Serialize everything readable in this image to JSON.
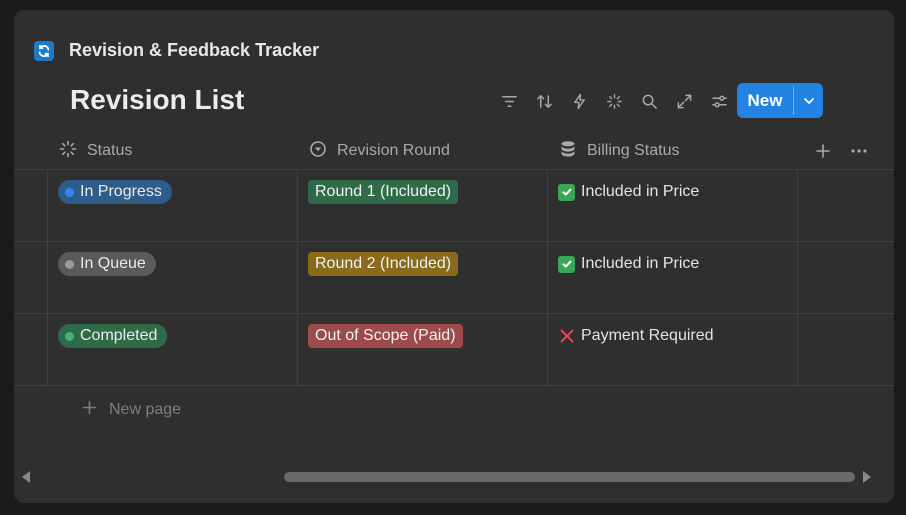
{
  "database": {
    "title": "Revision & Feedback Tracker",
    "icon": "sync-icon"
  },
  "view": {
    "title": "Revision List"
  },
  "toolbar": {
    "icons": [
      "filter-icon",
      "sort-icon",
      "automation-icon",
      "ai-sparkle-icon",
      "search-icon",
      "expand-icon",
      "settings-sliders-icon"
    ],
    "new_label": "New"
  },
  "columns": [
    {
      "label": "Status",
      "icon": "status-spinner-icon"
    },
    {
      "label": "Revision Round",
      "icon": "select-chevron-icon"
    },
    {
      "label": "Billing Status",
      "icon": "database-icon"
    }
  ],
  "rows": [
    {
      "status": {
        "label": "In Progress",
        "color": "#2f5d8a",
        "dot": "#3b82f6"
      },
      "round": {
        "label": "Round 1 (Included)",
        "color": "#2f6b4b"
      },
      "billing": {
        "label": "Included in Price",
        "icon": "check-box-icon"
      }
    },
    {
      "status": {
        "label": "In Queue",
        "color": "#5a5a5a",
        "dot": "#9b9b9b"
      },
      "round": {
        "label": "Round 2 (Included)",
        "color": "#8a6a1d"
      },
      "billing": {
        "label": "Included in Price",
        "icon": "check-box-icon"
      }
    },
    {
      "status": {
        "label": "Completed",
        "color": "#2f6b4b",
        "dot": "#4caf72"
      },
      "round": {
        "label": "Out of Scope (Paid)",
        "color": "#9c4a4a"
      },
      "billing": {
        "label": "Payment Required",
        "icon": "cross-mark-icon"
      }
    }
  ],
  "new_page_label": "New page",
  "colors": {
    "accent": "#2383e2",
    "panel": "#2f2f2f",
    "background": "#1b1b1b"
  }
}
